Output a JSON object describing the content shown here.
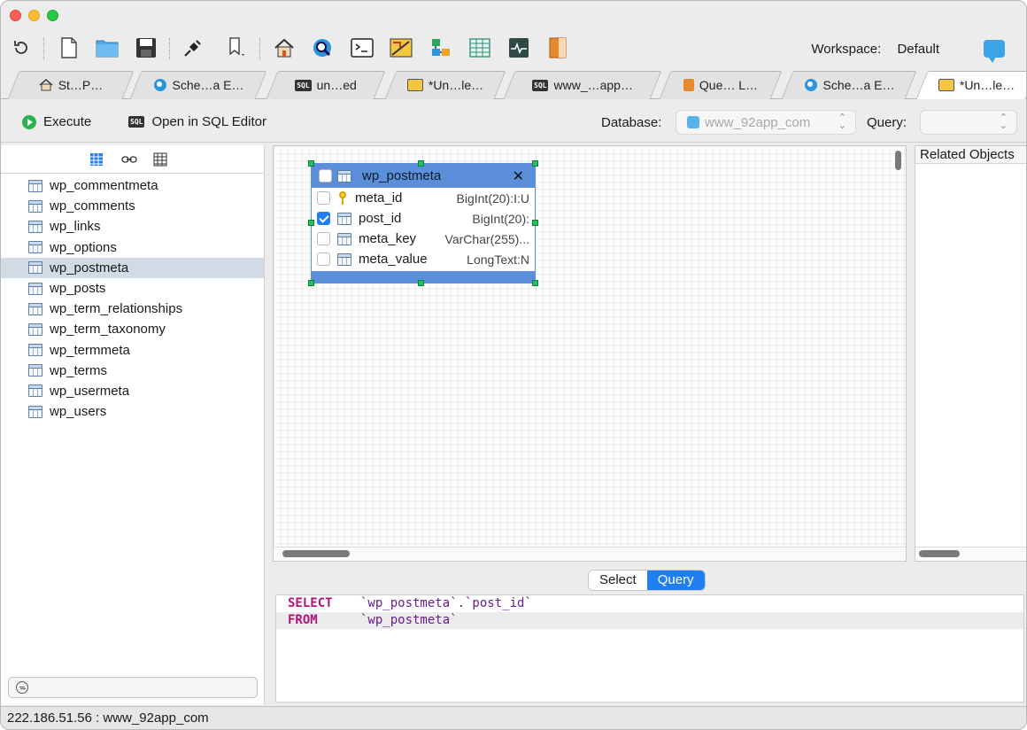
{
  "toolbar": {
    "workspace_label": "Workspace:",
    "workspace_value": "Default"
  },
  "tabs": [
    {
      "label": "St…P…",
      "icon": "home-icon"
    },
    {
      "label": "Sche…a E…",
      "icon": "schema-icon"
    },
    {
      "label": "un…ed",
      "icon": "sql-icon"
    },
    {
      "label": "*Un…le…",
      "icon": "query-builder-icon"
    },
    {
      "label": "www_…app…",
      "icon": "sql-icon"
    },
    {
      "label": "Que… L…",
      "icon": "book-icon"
    },
    {
      "label": "Sche…a E…",
      "icon": "schema-icon"
    },
    {
      "label": "*Un…le…",
      "icon": "query-builder-icon",
      "active": true
    }
  ],
  "actions": {
    "execute_label": "Execute",
    "open_sql_label": "Open in SQL Editor",
    "sql_badge": "SQL",
    "database_label": "Database:",
    "database_value": "www_92app_com",
    "query_label": "Query:",
    "query_value": ""
  },
  "sidebar": {
    "tables": [
      "wp_commentmeta",
      "wp_comments",
      "wp_links",
      "wp_options",
      "wp_postmeta",
      "wp_posts",
      "wp_term_relationships",
      "wp_term_taxonomy",
      "wp_termmeta",
      "wp_terms",
      "wp_usermeta",
      "wp_users"
    ],
    "selected_index": 4
  },
  "entity": {
    "name": "wp_postmeta",
    "close_glyph": "✕",
    "columns": [
      {
        "name": "meta_id",
        "type": "BigInt(20):I:U",
        "checked": false,
        "icon": "key-icon"
      },
      {
        "name": "post_id",
        "type": "BigInt(20):",
        "checked": true,
        "icon": "column-icon"
      },
      {
        "name": "meta_key",
        "type": "VarChar(255)...",
        "checked": false,
        "icon": "column-icon"
      },
      {
        "name": "meta_value",
        "type": "LongText:N",
        "checked": false,
        "icon": "column-icon"
      }
    ]
  },
  "related": {
    "title": "Related Objects"
  },
  "mode": {
    "select_label": "Select",
    "query_label": "Query",
    "active": "Query"
  },
  "editor": {
    "line1_kw": "SELECT",
    "line1_rest": "`wp_postmeta`.`post_id`",
    "line2_kw": "FROM",
    "line2_rest": "`wp_postmeta`"
  },
  "status": {
    "text": "222.186.51.56 : www_92app_com"
  },
  "colors": {
    "accent": "#1f7ff2",
    "entity_header": "#5b8fdb",
    "sql_keyword": "#b5117b",
    "sql_identifier": "#6a1c8f"
  }
}
